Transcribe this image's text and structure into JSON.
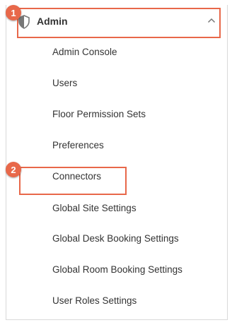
{
  "menu": {
    "header_label": "Admin",
    "header_icon": "shield-icon",
    "chevron_icon": "chevron-up-icon",
    "items": [
      {
        "label": "Admin Console"
      },
      {
        "label": "Users"
      },
      {
        "label": "Floor Permission Sets"
      },
      {
        "label": "Preferences"
      },
      {
        "label": "Connectors"
      },
      {
        "label": "Global Site Settings"
      },
      {
        "label": "Global Desk Booking Settings"
      },
      {
        "label": "Global Room Booking Settings"
      },
      {
        "label": "User Roles Settings"
      }
    ]
  },
  "annotations": {
    "step_1": "1",
    "step_2": "2",
    "highlight_color": "#e8684a"
  },
  "colors": {
    "text": "#333333",
    "border": "#d9d9d9",
    "icon": "#777777"
  }
}
